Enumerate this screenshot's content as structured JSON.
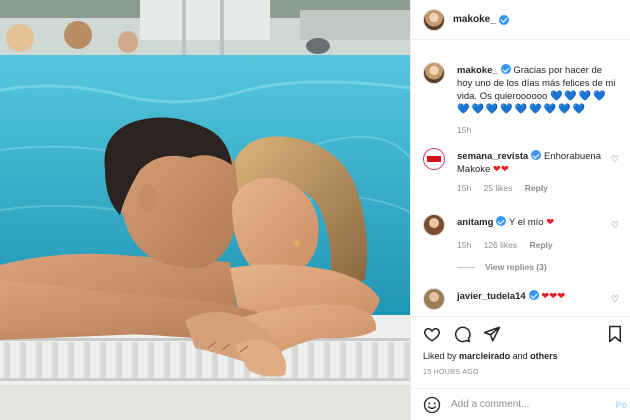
{
  "post": {
    "username": "makoke_",
    "caption_text": "Gracias por hacer de hoy uno de los días más felices de mi vida. Os quieroooooo",
    "caption_hearts": "💙💙💙💙💙💙💙💙💙💙💙💙💙",
    "caption_time": "15h"
  },
  "comments": [
    {
      "username": "semana_revista",
      "text": "Enhorabuena Makoke",
      "emoji": "❤❤",
      "time": "15h",
      "likes": "25 likes",
      "reply": "Reply"
    },
    {
      "username": "anitamg",
      "text": "Y el mío",
      "emoji": "❤",
      "time": "15h",
      "likes": "126 likes",
      "reply": "Reply"
    },
    {
      "username": "javier_tudela14",
      "text": "",
      "emoji": "❤❤❤",
      "time": "",
      "likes": "",
      "reply": ""
    }
  ],
  "view_replies": "View replies (3)",
  "likes": {
    "prefix": "Liked by",
    "user": "marcleirado",
    "joiner": "and",
    "rest": "others"
  },
  "timestamp": "15 HOURS AGO",
  "add_comment": {
    "placeholder": "Add a comment...",
    "post_label": "Po"
  },
  "icons": {
    "like": "heart-icon",
    "comment": "comment-icon",
    "share": "share-icon",
    "save": "bookmark-icon",
    "emoji": "emoji-icon"
  },
  "colors": {
    "accent": "#3897f0",
    "heart_red": "#ed1c24",
    "pool": "#3fb6cf",
    "border": "#efefef"
  }
}
